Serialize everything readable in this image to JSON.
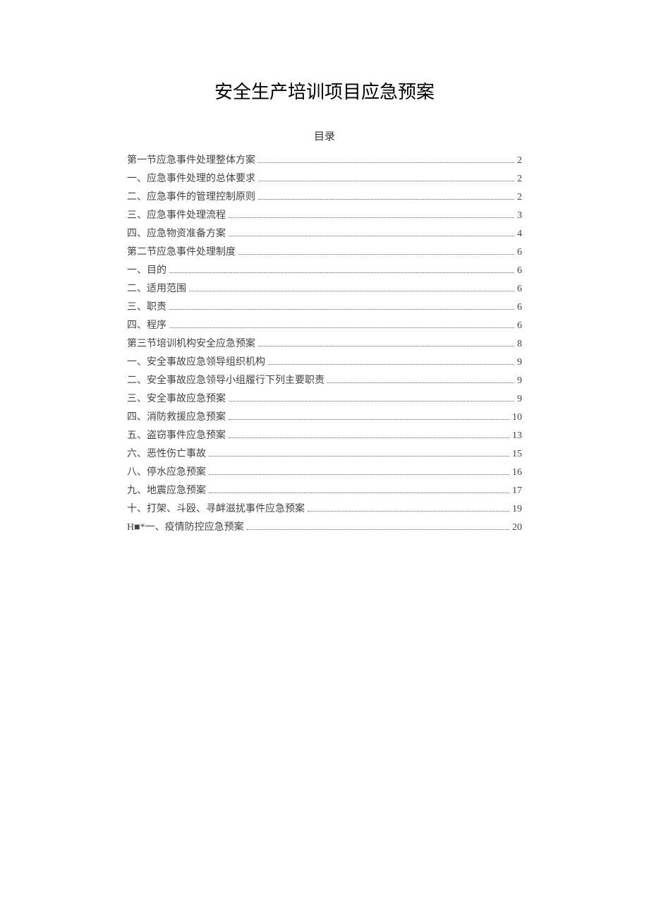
{
  "title": "安全生产培训项目应急预案",
  "toc_heading": "目录",
  "toc": [
    {
      "label": "第一节应急事件处理整体方案",
      "page": "2"
    },
    {
      "label": "一、应急事件处理的总体要求",
      "page": "2"
    },
    {
      "label": "二、应急事件的管理控制原则",
      "page": "2"
    },
    {
      "label": "三、应急事件处理流程",
      "page": "3"
    },
    {
      "label": "四、应急物资准备方案",
      "page": "4"
    },
    {
      "label": "第二节应急事件处理制度",
      "page": "6"
    },
    {
      "label": "一、目的",
      "page": "6"
    },
    {
      "label": "二、适用范围",
      "page": "6"
    },
    {
      "label": "三、职责",
      "page": "6"
    },
    {
      "label": "四、程序",
      "page": "6"
    },
    {
      "label": "第三节培训机构安全应急预案",
      "page": "8"
    },
    {
      "label": "一、安全事故应急领导组织机构",
      "page": "9"
    },
    {
      "label": "二、安全事故应急领导小组履行下列主要职责",
      "page": "9"
    },
    {
      "label": "三、安全事故应急预案",
      "page": "9"
    },
    {
      "label": "四、消防救援应急预案",
      "page": "10"
    },
    {
      "label": "五、盗窃事件应急预案",
      "page": "13"
    },
    {
      "label": "六、恶性伤亡事故",
      "page": "15"
    },
    {
      "label": "八、停水应急预案",
      "page": "16"
    },
    {
      "label": "九、地震应急预案",
      "page": "17"
    },
    {
      "label": "十、打架、斗殴、寻衅滋扰事件应急预案",
      "page": "19"
    },
    {
      "label": "H■*一、疫情防控应急预案",
      "page": "20"
    }
  ]
}
